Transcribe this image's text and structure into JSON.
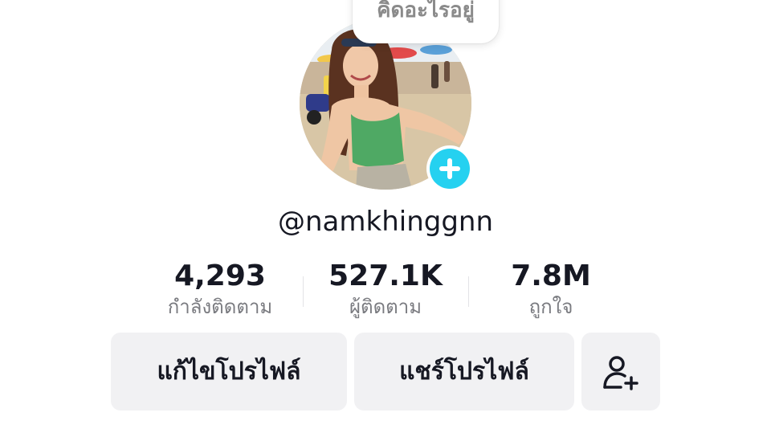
{
  "bubble": {
    "text": "คิดอะไรอยู่"
  },
  "profile": {
    "username": "@namkhinggnn",
    "avatar_icon": "profile-photo",
    "add_badge_icon": "plus-icon",
    "accent_color": "#25d1f0"
  },
  "stats": {
    "following": {
      "value": "4,293",
      "label": "กำลังติดตาม"
    },
    "followers": {
      "value": "527.1K",
      "label": "ผู้ติดตาม"
    },
    "likes": {
      "value": "7.8M",
      "label": "ถูกใจ"
    }
  },
  "actions": {
    "edit_label": "แก้ไขโปรไฟล์",
    "share_label": "แชร์โปรไฟล์",
    "add_friend_icon": "add-user-icon"
  }
}
